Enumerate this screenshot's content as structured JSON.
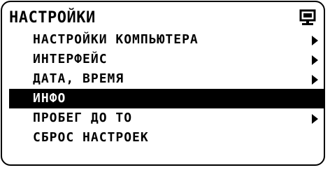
{
  "title": "НАСТРОЙКИ",
  "title_icon": "monitor-icon",
  "menu": {
    "items": [
      {
        "label": "НАСТРОЙКИ КОМПЬЮТЕРА",
        "has_submenu": true,
        "selected": false
      },
      {
        "label": "ИНТЕРФЕЙС",
        "has_submenu": true,
        "selected": false
      },
      {
        "label": "ДАТА, ВРЕМЯ",
        "has_submenu": true,
        "selected": false
      },
      {
        "label": "ИНФО",
        "has_submenu": false,
        "selected": true
      },
      {
        "label": "ПРОБЕГ ДО ТО",
        "has_submenu": true,
        "selected": false
      },
      {
        "label": "СБРОС НАСТРОЕК",
        "has_submenu": false,
        "selected": false
      }
    ]
  },
  "colors": {
    "foreground": "#000000",
    "background": "#ffffff",
    "selection": "#000000"
  }
}
